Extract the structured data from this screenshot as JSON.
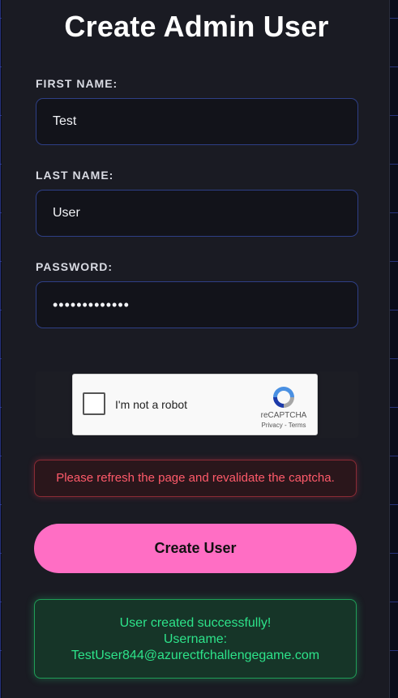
{
  "form": {
    "title": "Create Admin User",
    "first_name": {
      "label": "FIRST NAME:",
      "value": "Test"
    },
    "last_name": {
      "label": "LAST NAME:",
      "value": "User"
    },
    "password": {
      "label": "PASSWORD:",
      "value": "•••••••••••••"
    },
    "submit_label": "Create User"
  },
  "captcha": {
    "text": "I'm not a robot",
    "brand": "reCAPTCHA",
    "links": "Privacy - Terms",
    "checked": false
  },
  "messages": {
    "error": "Please refresh the page and revalidate the captcha.",
    "success_line1": "User created successfully!",
    "success_line2": "Username:",
    "success_line3": "TestUser844@azurectfchallengegame.com"
  },
  "colors": {
    "accent": "#ff6ec4",
    "error": "#ff5a6a",
    "success": "#2de38a",
    "field_border": "#2e3f86"
  }
}
